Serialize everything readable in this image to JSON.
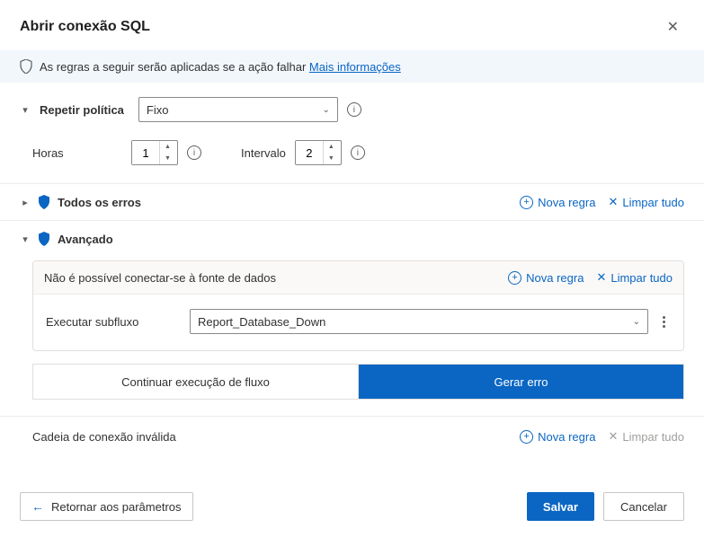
{
  "dialog": {
    "title": "Abrir conexão SQL"
  },
  "banner": {
    "text": "As regras a seguir serão aplicadas se a ação falhar ",
    "link": "Mais informações"
  },
  "retry": {
    "label": "Repetir política",
    "policy_selected": "Fixo",
    "hours_label": "Horas",
    "hours_value": "1",
    "interval_label": "Intervalo",
    "interval_value": "2"
  },
  "all_errors": {
    "title": "Todos os erros",
    "new_rule": "Nova regra",
    "clear_all": "Limpar tudo"
  },
  "advanced": {
    "title": "Avançado",
    "error1": {
      "title": "Não é possível conectar-se à fonte de dados",
      "new_rule": "Nova regra",
      "clear_all": "Limpar tudo",
      "action_label": "Executar subfluxo",
      "subflow_selected": "Report_Database_Down",
      "continue_label": "Continuar execução de fluxo",
      "throw_label": "Gerar erro"
    },
    "error2": {
      "title": "Cadeia de conexão inválida",
      "new_rule": "Nova regra",
      "clear_all": "Limpar tudo"
    }
  },
  "footer": {
    "back": "Retornar aos parâmetros",
    "save": "Salvar",
    "cancel": "Cancelar"
  }
}
